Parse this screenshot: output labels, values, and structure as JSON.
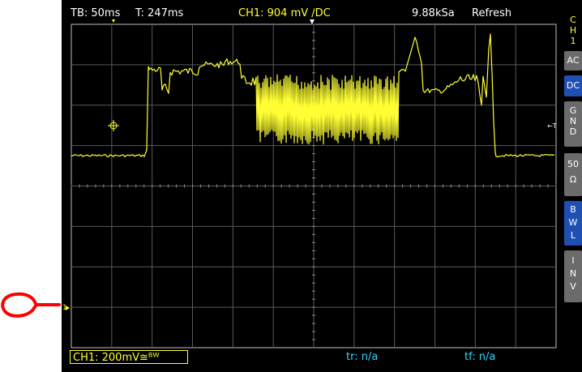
{
  "status": {
    "timebase": "TB: 50ms",
    "trigger_time": "T: 247ms",
    "channel_info": "CH1: 904 mV ∕DC",
    "sample_rate": "9.88kSa",
    "mode": "Refresh"
  },
  "bottom": {
    "channel_scale": "CH1: 200mV≅ᴮᵂ",
    "rise_time": "tr: n/a",
    "fall_time": "tf: n/a"
  },
  "side_panel": {
    "header": [
      "C",
      "H",
      "1"
    ],
    "ac": "AC",
    "dc": "DC",
    "gnd": [
      "G",
      "N",
      "D"
    ],
    "fifty": [
      "50",
      "Ω"
    ],
    "bwl": [
      "B",
      "W",
      "L"
    ],
    "inv": [
      "I",
      "N",
      "V"
    ]
  },
  "markers": {
    "channel_ground": "1",
    "trigger_right": "←T"
  },
  "colors": {
    "trace": "#ffff33",
    "grid": "#5a5a5a",
    "active_button": "#1f4fb3",
    "button": "#6b6b6b",
    "measurement": "#33d6ff",
    "annotation": "#ff0000"
  },
  "waveform": {
    "channel": "CH1",
    "coupling": "DC",
    "volts_per_div": "200mV",
    "time_per_div": "50ms"
  }
}
